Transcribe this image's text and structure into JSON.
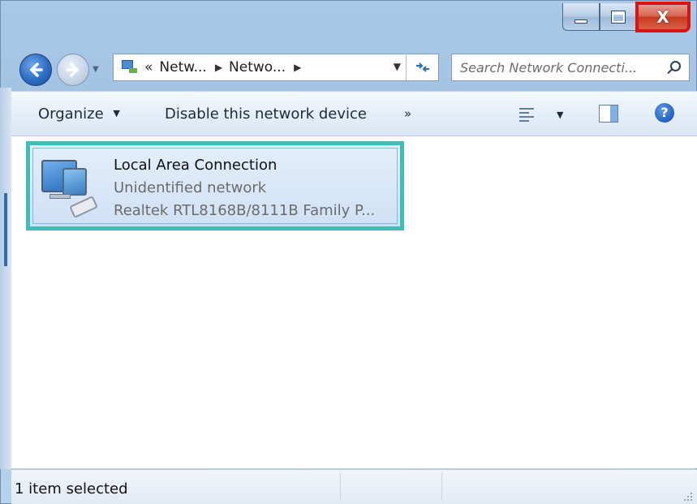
{
  "window": {
    "minimize_icon": "minimize-icon",
    "maximize_icon": "maximize-icon",
    "close_icon": "close-icon",
    "close_glyph": "X",
    "close_highlight_color": "#e01111"
  },
  "navigation": {
    "back_icon": "back-arrow-icon",
    "forward_icon": "forward-arrow-icon",
    "breadcrumb": {
      "overflow": "«",
      "items": [
        "Netw...",
        "Netwo..."
      ],
      "separator": "▶"
    },
    "refresh_icon": "refresh-icon",
    "search": {
      "placeholder": "Search Network Connecti...",
      "icon": "search-icon"
    }
  },
  "toolbar": {
    "organize_label": "Organize",
    "disable_label": "Disable this network device",
    "more_label": "»",
    "caret": "▼",
    "view_icon": "change-view-icon",
    "preview_pane_icon": "preview-pane-icon",
    "help_glyph": "?"
  },
  "content": {
    "items": [
      {
        "name": "Local Area Connection",
        "status": "Unidentified network",
        "adapter": "Realtek RTL8168B/8111B Family P...",
        "icon": "network-connection-icon",
        "selected": true,
        "highlight_color": "#3dbfb8"
      }
    ]
  },
  "statusbar": {
    "text": "1 item selected"
  }
}
